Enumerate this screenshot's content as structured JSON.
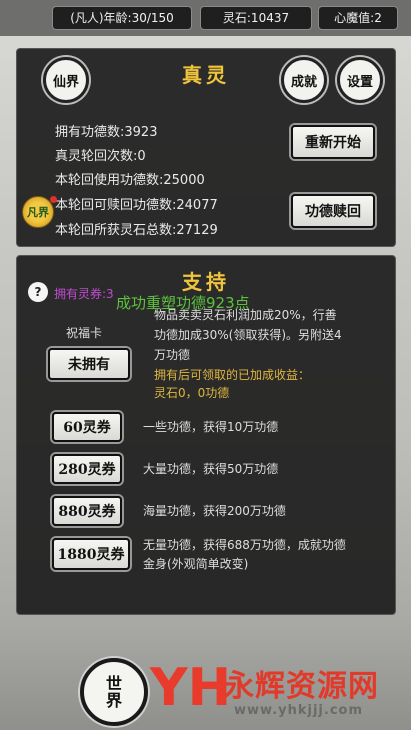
{
  "status_bar": {
    "age": "(凡人)年龄:30/150",
    "spirit_stones": "灵石:10437",
    "demon_value": "心魔值:2"
  },
  "true_spirit_panel": {
    "title": "真灵",
    "left_button": "仙界",
    "right_buttons": [
      "成就",
      "设置"
    ],
    "stats": [
      "拥有功德数:3923",
      "真灵轮回次数:0",
      "本轮回使用功德数:25000",
      "本轮回可赎回功德数:24077",
      "本轮回所获灵石总数:27129"
    ],
    "restart_button": "重新开始",
    "redeem_button": "功德赎回",
    "badge_icon_text": "凡界"
  },
  "support_panel": {
    "title": "支持",
    "help_icon": "?",
    "coupons_owned": "拥有灵券:3",
    "toast": "成功重塑功德923点",
    "blessing_card": {
      "label": "祝福卡",
      "button": "未拥有",
      "desc_line1": "物品卖卖灵石利润加成20%，行善",
      "desc_line2": "功德加成30%(领取获得)。另附送4",
      "desc_line3": "万功德",
      "pending_label": "拥有后可领取的已加成收益：",
      "pending_value": "灵石0，0功德"
    },
    "packs": [
      {
        "button": "60灵券",
        "desc": "一些功德，获得10万功德"
      },
      {
        "button": "280灵券",
        "desc": "大量功德，获得50万功德"
      },
      {
        "button": "880灵券",
        "desc": "海量功德，获得200万功德"
      },
      {
        "button": "1880灵券",
        "desc_line1": "无量功德，获得688万功德，成就功德",
        "desc_line2": "金身(外观简单改变)"
      }
    ]
  },
  "bottom_nav": {
    "world_button": "世界"
  },
  "watermark": {
    "logo": "YH",
    "name": "永辉资源网",
    "url": "www.yhkjjj.com"
  },
  "colors": {
    "title_gold": "#f0c53b",
    "toast_green": "#5cc23e",
    "pending_gold": "#e0b640"
  }
}
